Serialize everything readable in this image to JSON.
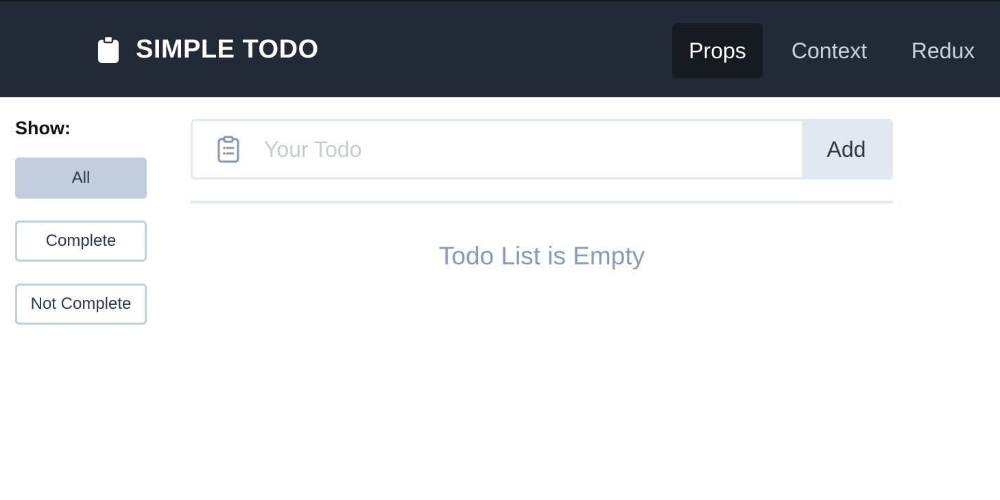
{
  "header": {
    "brand_icon": "clipboard-icon",
    "title": "SIMPLE TODO",
    "nav": [
      {
        "label": "Props",
        "active": true
      },
      {
        "label": "Context",
        "active": false
      },
      {
        "label": "Redux",
        "active": false
      }
    ]
  },
  "filters": {
    "heading": "Show:",
    "options": [
      {
        "label": "All",
        "active": true
      },
      {
        "label": "Complete",
        "active": false
      },
      {
        "label": "Not Complete",
        "active": false
      }
    ]
  },
  "todo_form": {
    "icon": "clipboard-list-icon",
    "value": "",
    "placeholder": "Your Todo",
    "add_label": "Add"
  },
  "todo_list": {
    "items": [],
    "empty_message": "Todo List is Empty"
  },
  "colors": {
    "navbar_bg": "#232a37",
    "nav_active_bg": "#161b22",
    "filter_active_bg": "#c2cedb",
    "empty_text": "#8a9bb2"
  }
}
